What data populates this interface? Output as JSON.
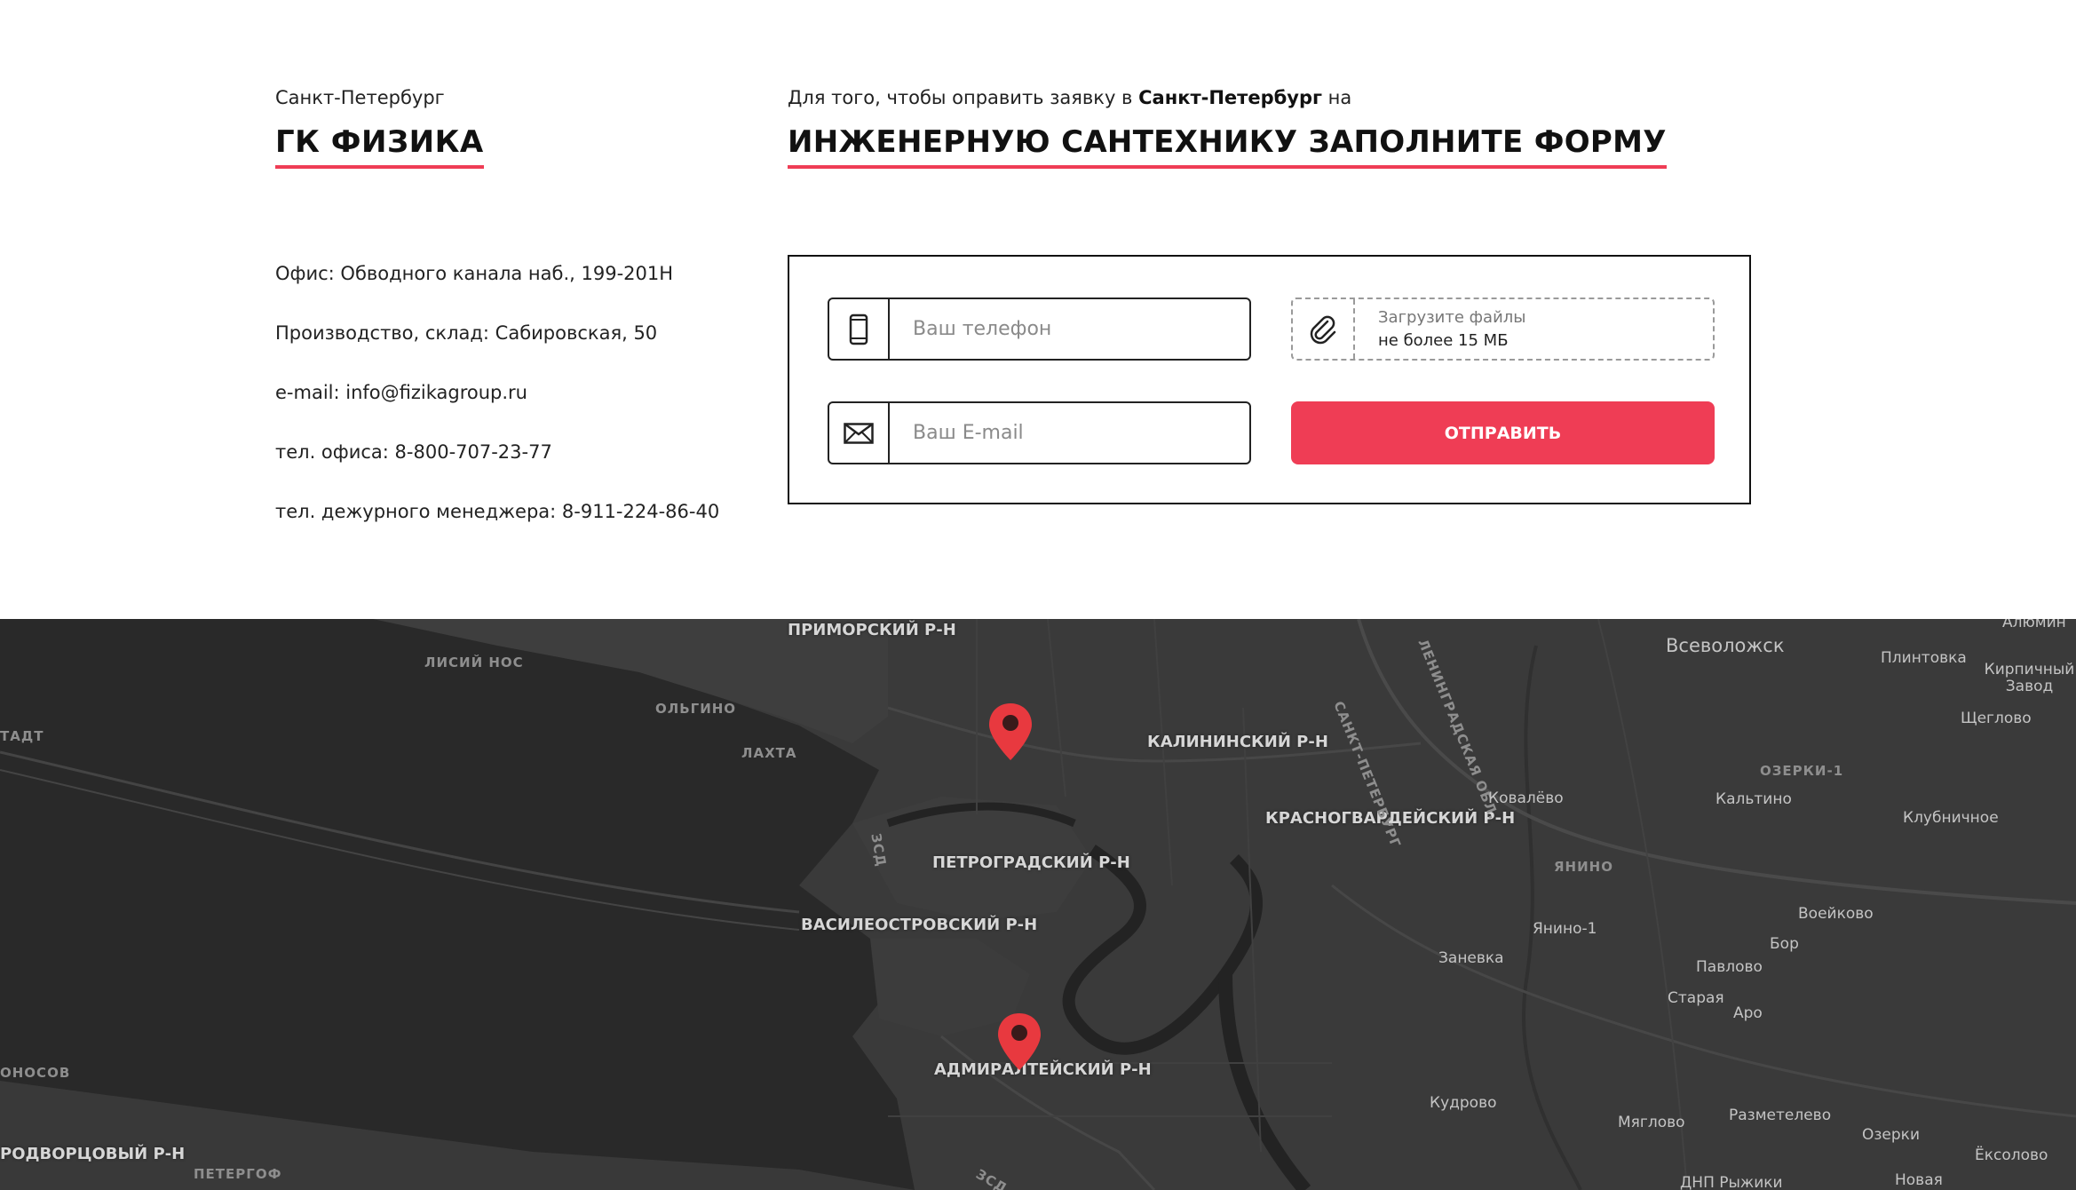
{
  "company": {
    "city": "Санкт-Петербург",
    "name": "ГК ФИЗИКА"
  },
  "contacts": [
    "Офис: Обводного канала наб., 199-201Н",
    "Производство, склад: Сабировская, 50",
    "e-mail: info@fizikagroup.ru",
    "тел. офиса: 8-800-707-23-77",
    "тел. дежурного менеджера: 8-911-224-86-40"
  ],
  "form": {
    "intro_prefix": "Для того, чтобы оправить заявку в ",
    "intro_city": "Санкт-Петербург",
    "intro_suffix": " на",
    "title": "ИНЖЕНЕРНУЮ САНТЕХНИКУ ЗАПОЛНИТЕ ФОРМУ",
    "phone_placeholder": "Ваш телефон",
    "email_placeholder": "Ваш E-mail",
    "upload_line1": "Загрузите файлы",
    "upload_line2": "не более 15 МБ",
    "submit_label": "ОТПРАВИТЬ",
    "phone_icon": "phone-icon",
    "email_icon": "envelope-icon",
    "upload_icon": "paperclip-icon",
    "accent_color": "#ef3d55"
  },
  "map": {
    "background_color": "#333333",
    "marker_color": "#e8393f",
    "districts": [
      "ПРИМОРСКИЙ Р-Н",
      "КАЛИНИНСКИЙ Р-Н",
      "КРАСНОГВАРДЕЙСКИЙ Р-Н",
      "ПЕТРОГРАДСКИЙ Р-Н",
      "ВАСИЛЕОСТРОВСКИЙ Р-Н",
      "АДМИРАЛТЕЙСКИЙ Р-Н",
      "РОДВОРЦОВЫЙ Р-Н"
    ],
    "small_labels": [
      "ЛИСИЙ НОС",
      "ОЛЬГИНО",
      "ЛАХТА",
      "ТАДТ",
      "ОЗЕРКИ-1",
      "ЯНИНО",
      "ОНОСОВ",
      "ПЕТЕРГОФ",
      "САНКТ-ПЕТЕРБУРГ",
      "ЛЕНИНГРАДСКАЯ ОБЛ.",
      "ЗСД",
      "ЗСД"
    ],
    "towns": [
      "Всеволожск",
      "Плинтовка",
      "Кирпичный Завод",
      "Щеглово",
      "Кальтино",
      "Ковалёво",
      "Клубничное",
      "Воейково",
      "Янино-1",
      "Бор",
      "Заневка",
      "Павлово",
      "Старая",
      "Аро",
      "Кудрово",
      "Мяглово",
      "Разметелево",
      "Озерки",
      "Ёксолово",
      "ДНП Рыжики",
      "Новая",
      "Алюмин"
    ]
  }
}
